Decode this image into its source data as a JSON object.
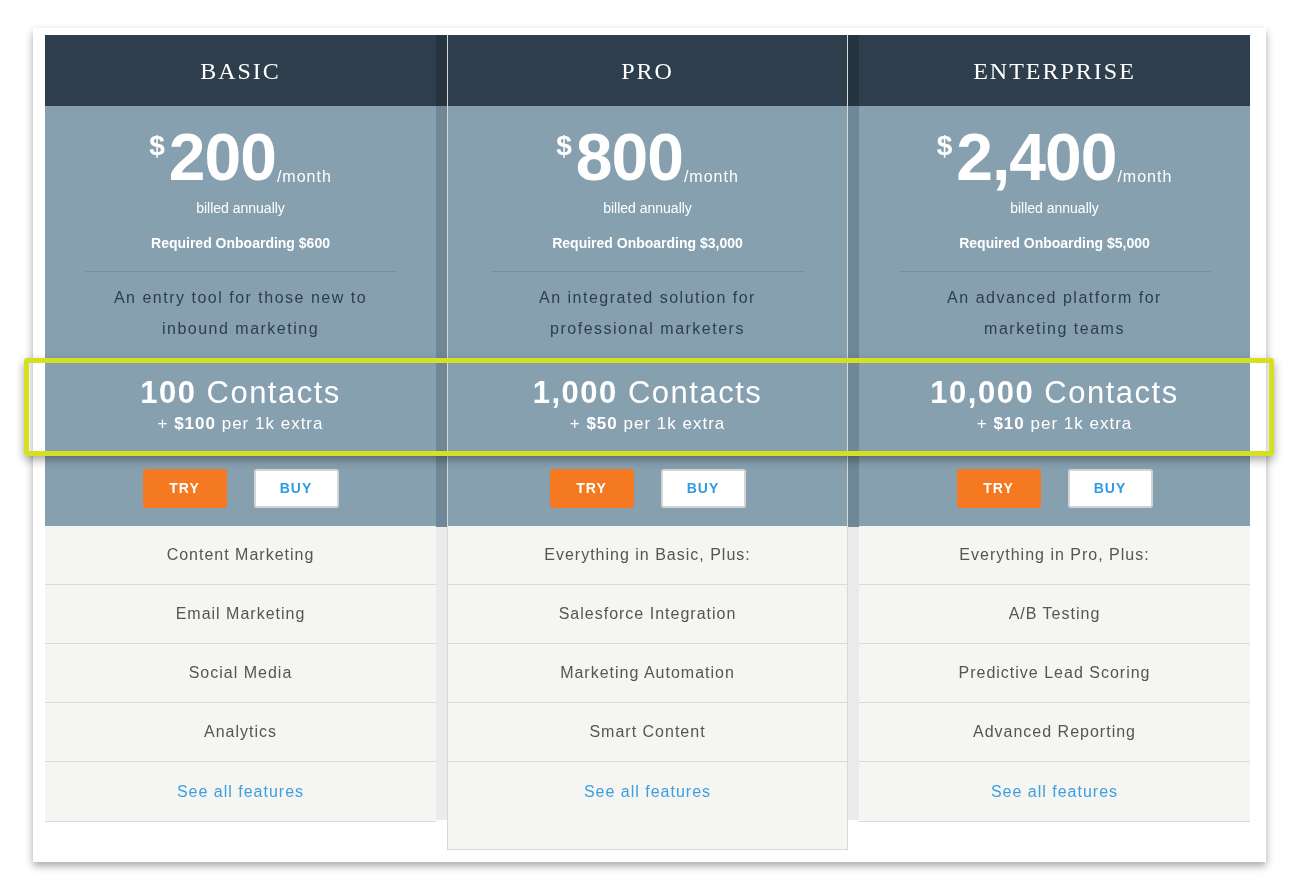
{
  "plans": [
    {
      "name": "BASIC",
      "featured": false,
      "price": {
        "currency": "$",
        "amount": "200",
        "period": "/month"
      },
      "billing": "billed annually",
      "onboarding": "Required Onboarding $600",
      "description": "An entry tool for those new to inbound marketing",
      "contacts": "**100** Contacts",
      "extra": "+ **$100** per 1k extra",
      "buttons": [
        {
          "kind": "try",
          "label": "TRY"
        },
        {
          "kind": "buy",
          "label": "BUY"
        }
      ],
      "features": [
        {
          "kind": "feature",
          "text": "Content Marketing"
        },
        {
          "kind": "feature",
          "text": "Email Marketing"
        },
        {
          "kind": "feature",
          "text": "Social Media"
        },
        {
          "kind": "feature",
          "text": "Analytics"
        },
        {
          "kind": "link",
          "text": "See all features"
        }
      ]
    },
    {
      "name": "PRO",
      "featured": true,
      "price": {
        "currency": "$",
        "amount": "800",
        "period": "/month"
      },
      "billing": "billed annually",
      "onboarding": "Required Onboarding $3,000",
      "description": "An integrated solution for professional marketers",
      "contacts": "**1,000** Contacts",
      "extra": "+ **$50** per 1k extra",
      "buttons": [
        {
          "kind": "try",
          "label": "TRY"
        },
        {
          "kind": "buy",
          "label": "BUY"
        }
      ],
      "features": [
        {
          "kind": "feature",
          "text": "Everything in Basic, Plus:"
        },
        {
          "kind": "feature",
          "text": "Salesforce Integration"
        },
        {
          "kind": "feature",
          "text": "Marketing Automation"
        },
        {
          "kind": "feature",
          "text": "Smart Content"
        },
        {
          "kind": "link",
          "text": "See all features"
        }
      ]
    },
    {
      "name": "ENTERPRISE",
      "featured": false,
      "price": {
        "currency": "$",
        "amount": "2,400",
        "period": "/month"
      },
      "billing": "billed annually",
      "onboarding": "Required Onboarding $5,000",
      "description": "An advanced platform for marketing teams",
      "contacts": "**10,000** Contacts",
      "extra": "+ **$10** per 1k extra",
      "buttons": [
        {
          "kind": "try",
          "label": "TRY"
        },
        {
          "kind": "buy",
          "label": "BUY"
        }
      ],
      "features": [
        {
          "kind": "feature",
          "text": "Everything in Pro, Plus:"
        },
        {
          "kind": "feature",
          "text": "A/B Testing"
        },
        {
          "kind": "feature",
          "text": "Predictive Lead Scoring"
        },
        {
          "kind": "feature",
          "text": "Advanced Reporting"
        },
        {
          "kind": "link",
          "text": "See all features"
        }
      ]
    }
  ]
}
